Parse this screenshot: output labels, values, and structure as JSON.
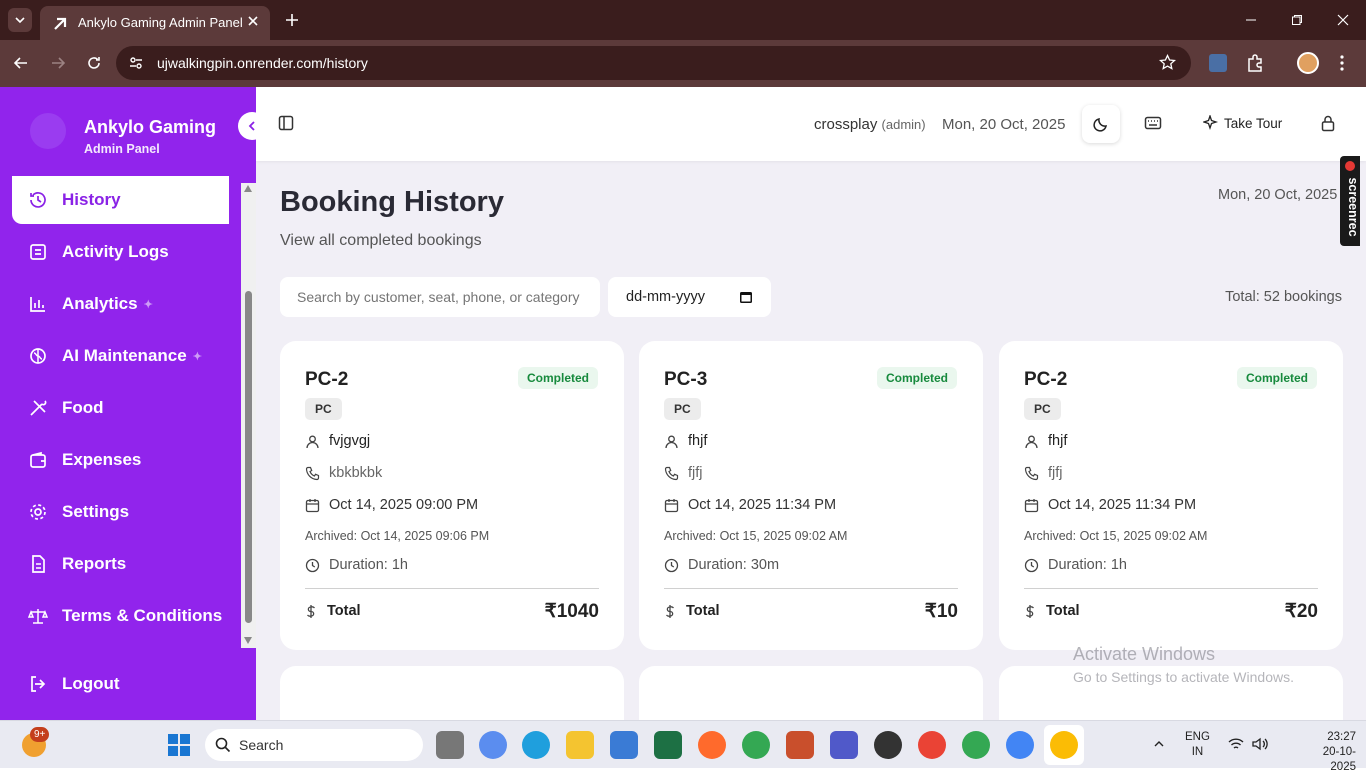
{
  "browser": {
    "tab_title": "Ankylo Gaming Admin Panel",
    "url": "ujwalkingpin.onrender.com/history"
  },
  "sidebar": {
    "brand": "Ankylo Gaming",
    "subtitle": "Admin Panel",
    "items": [
      {
        "label": "History",
        "icon": "history-icon",
        "active": true
      },
      {
        "label": "Activity Logs",
        "icon": "logs-icon"
      },
      {
        "label": "Analytics",
        "icon": "chart-icon"
      },
      {
        "label": "AI Maintenance",
        "icon": "brain-icon"
      },
      {
        "label": "Food",
        "icon": "utensils-icon"
      },
      {
        "label": "Expenses",
        "icon": "wallet-icon"
      },
      {
        "label": "Settings",
        "icon": "gear-icon"
      },
      {
        "label": "Reports",
        "icon": "report-icon"
      },
      {
        "label": "Terms & Conditions",
        "icon": "scale-icon"
      }
    ],
    "logout": "Logout"
  },
  "header": {
    "user": "crossplay",
    "role": "(admin)",
    "date": "Mon, 20 Oct, 2025",
    "tour_label": "Take Tour"
  },
  "page": {
    "title": "Booking History",
    "subtitle": "View all completed bookings",
    "date": "Mon, 20 Oct, 2025",
    "search_placeholder": "Search by customer, seat, phone, or category",
    "date_placeholder": "dd-mm-yyyy",
    "total": "Total: 52 bookings"
  },
  "bookings": [
    {
      "seat": "PC-2",
      "status": "Completed",
      "category": "PC",
      "customer": "fvjgvgj",
      "phone": "kbkbkbk",
      "datetime": "Oct 14, 2025 09:00 PM",
      "archived": "Archived: Oct 14, 2025 09:06 PM",
      "duration": "Duration: 1h",
      "total_label": "Total",
      "amount": "₹1040"
    },
    {
      "seat": "PC-3",
      "status": "Completed",
      "category": "PC",
      "customer": "fhjf",
      "phone": "fjfj",
      "datetime": "Oct 14, 2025 11:34 PM",
      "archived": "Archived: Oct 15, 2025 09:02 AM",
      "duration": "Duration: 30m",
      "total_label": "Total",
      "amount": "₹10"
    },
    {
      "seat": "PC-2",
      "status": "Completed",
      "category": "PC",
      "customer": "fhjf",
      "phone": "fjfj",
      "datetime": "Oct 14, 2025 11:34 PM",
      "archived": "Archived: Oct 15, 2025 09:02 AM",
      "duration": "Duration: 1h",
      "total_label": "Total",
      "amount": "₹20"
    }
  ],
  "overlay": {
    "screenrec": "screenrec",
    "activate_title": "Activate Windows",
    "activate_sub": "Go to Settings to activate Windows."
  },
  "taskbar": {
    "search": "Search",
    "badge": "9+",
    "lang": "ENG",
    "region": "IN",
    "time": "23:27",
    "date": "20-10-2025"
  },
  "colors": {
    "sidebar": "#9124ec",
    "accent": "#8a22e6",
    "chrome": "#3a1d1d",
    "status_green": "#178a3d"
  }
}
